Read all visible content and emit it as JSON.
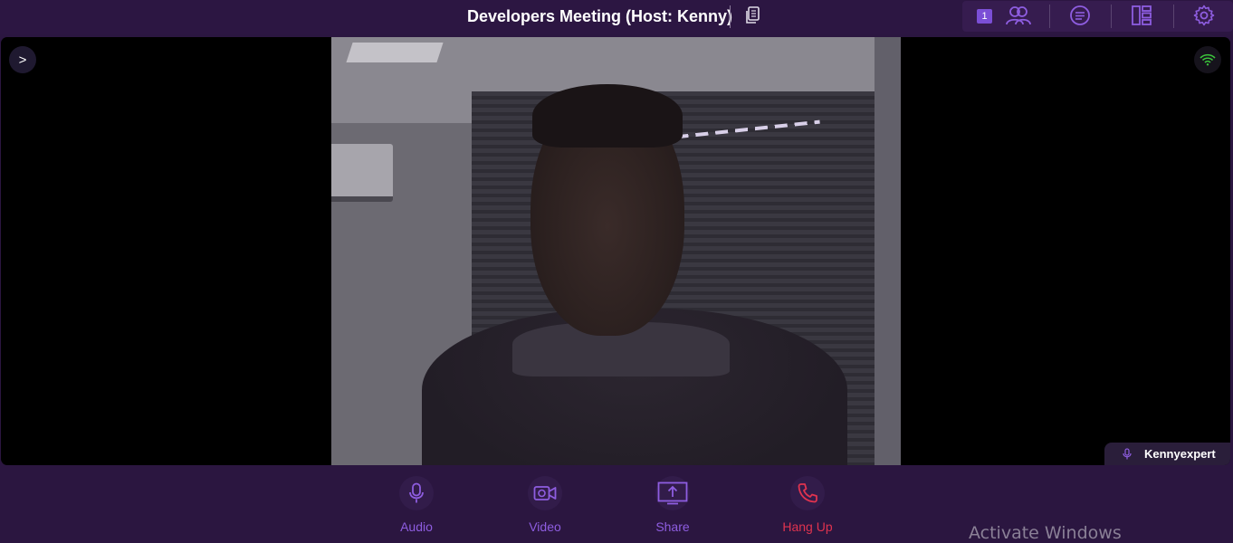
{
  "meeting": {
    "title": "Developers Meeting (Host: Kenny)"
  },
  "toolbar": {
    "participant_count": "1",
    "icons": [
      "participants-icon",
      "chat-icon",
      "layout-icon",
      "settings-icon"
    ]
  },
  "stage": {
    "sidebar_toggle_label": ">",
    "participant_name": "Kennyexpert",
    "connection_icon": "wifi-signal-icon"
  },
  "controls": {
    "audio_label": "Audio",
    "video_label": "Video",
    "share_label": "Share",
    "hangup_label": "Hang Up"
  },
  "watermark": {
    "text": "Activate Windows"
  },
  "colors": {
    "background": "#2b1640",
    "accent": "#8e5de0",
    "hangup": "#e0334f",
    "badge": "#7b4fd6",
    "signal": "#3bc43b"
  }
}
